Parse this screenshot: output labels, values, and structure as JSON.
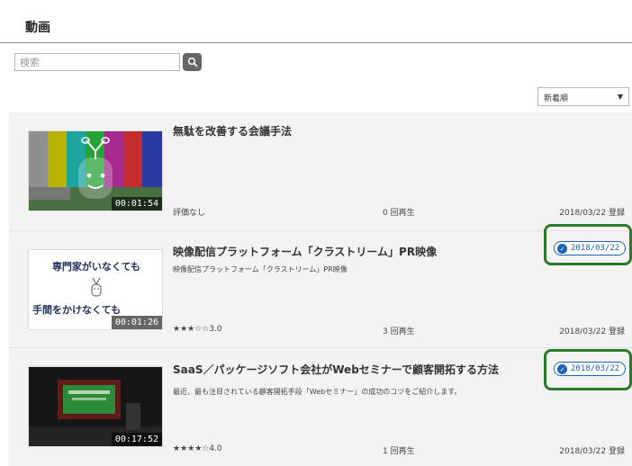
{
  "page": {
    "title": "動画"
  },
  "search": {
    "placeholder": "検索",
    "icon": "search-icon"
  },
  "sort": {
    "selected": "新着順",
    "icon": "dropdown-arrow-icon"
  },
  "colors": {
    "badge": "#1a66b8",
    "highlight": "#2b7a2b",
    "list_bg": "#f3f3f3"
  },
  "videos": [
    {
      "title": "無駄を改善する会議手法",
      "description": "",
      "duration": "00:01:54",
      "rating": "評価なし",
      "plays": "0 回再生",
      "registered": "2018/03/22 登録"
    },
    {
      "title": "映像配信プラットフォーム「クラストリーム」PR映像",
      "description": "映像配信プラットフォーム「クラストリーム」PR映像",
      "duration": "00:01:26",
      "thumb_line1": "専門家がいなくても",
      "thumb_line2": "手間をかけなくても",
      "stars_value": 3.0,
      "rating": "★★★☆☆3.0",
      "plays": "3 回再生",
      "registered": "2018/03/22 登録",
      "badge_date": "2018/03/22"
    },
    {
      "title": "SaaS／パッケージソフト会社がWebセミナーで顧客開拓する方法",
      "description": "最近、最も注目されている顧客開拓手段「Webセミナー」の成功のコツをご紹介します。",
      "duration": "00:17:52",
      "stars_value": 4.0,
      "rating": "★★★★☆4.0",
      "plays": "1 回再生",
      "registered": "2018/03/22 登録",
      "badge_date": "2018/03/22"
    }
  ]
}
